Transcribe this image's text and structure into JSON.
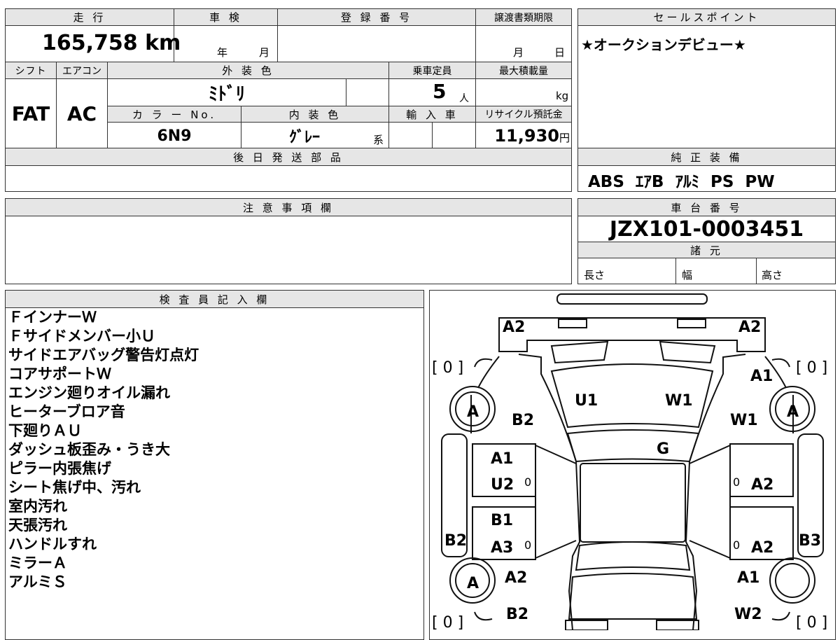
{
  "top_left": {
    "mileage_header": "走 行",
    "mileage_value": "165,758",
    "mileage_unit": "km",
    "inspection_header": "車 検",
    "inspection_year": "年",
    "inspection_month": "月",
    "registration_header": "登 録 番 号",
    "transfer_header": "譲渡書類期限",
    "transfer_month": "月",
    "transfer_day": "日"
  },
  "spec": {
    "shift_header": "シフト",
    "shift_value": "FAT",
    "ac_header": "エアコン",
    "ac_value": "AC",
    "exterior_header": "外 装 色",
    "exterior_value": "ﾐﾄﾞﾘ",
    "capacity_header": "乗車定員",
    "capacity_value": "5",
    "capacity_unit": "人",
    "load_header": "最大積載量",
    "load_unit": "kg",
    "color_no_header": "カ ラ ー No.",
    "color_no_value": "6N9",
    "interior_header": "内 装 色",
    "interior_value": "ｸﾞﾚｰ",
    "interior_suffix": "系",
    "import_header": "輸 入 車",
    "recycle_header": "リサイクル預託金",
    "recycle_value": "11,930",
    "recycle_unit": "円",
    "later_parts_header": "後 日 発 送 部 品"
  },
  "sales": {
    "header": "セールスポイント",
    "text": "★オークションデビュー★"
  },
  "equipment": {
    "header": "純 正 装 備",
    "text": "ABS  ｴｱB  ｱﾙﾐ  PS  PW"
  },
  "notes": {
    "header": "注 意 事 項 欄"
  },
  "chassis": {
    "header": "車 台 番 号",
    "value": "JZX101-0003451",
    "dims_header": "諸 元",
    "length_label": "長さ",
    "width_label": "幅",
    "height_label": "高さ"
  },
  "inspector": {
    "header": "検 査 員 記 入 欄",
    "items": [
      "ＦインナーＷ",
      "Ｆサイドメンバー小Ｕ",
      "サイドエアバッグ警告灯点灯",
      "コアサポートＷ",
      "エンジン廻りオイル漏れ",
      "ヒーターブロア音",
      "下廻りＡＵ",
      "ダッシュ板歪み・うき大",
      "ピラー内張焦げ",
      "シート焦げ中、汚れ",
      "室内汚れ",
      "天張汚れ",
      "ハンドルすれ",
      "ミラーＡ",
      "アルミＳ"
    ]
  },
  "diagram": {
    "bracket_zero": "0",
    "wheel_code": "A",
    "labels": {
      "front_left": "A2",
      "front_right": "A2",
      "fender_right": "A1",
      "hood_u": "U1",
      "hood_w": "W1",
      "fender_left": "B2",
      "fender_right_w": "W1",
      "windshield": "G",
      "front_door_left_1": "A1",
      "front_door_left_2": "U2",
      "front_door_right": "A2",
      "rear_door_left_1": "B1",
      "rear_door_left_2": "A3",
      "rear_door_right": "A2",
      "side_left": "B2",
      "side_right": "B3",
      "rear_fender_left": "A2",
      "rear_fender_right": "A1",
      "rear_left": "B2",
      "rear_right": "W2",
      "small_zero": "0"
    }
  }
}
